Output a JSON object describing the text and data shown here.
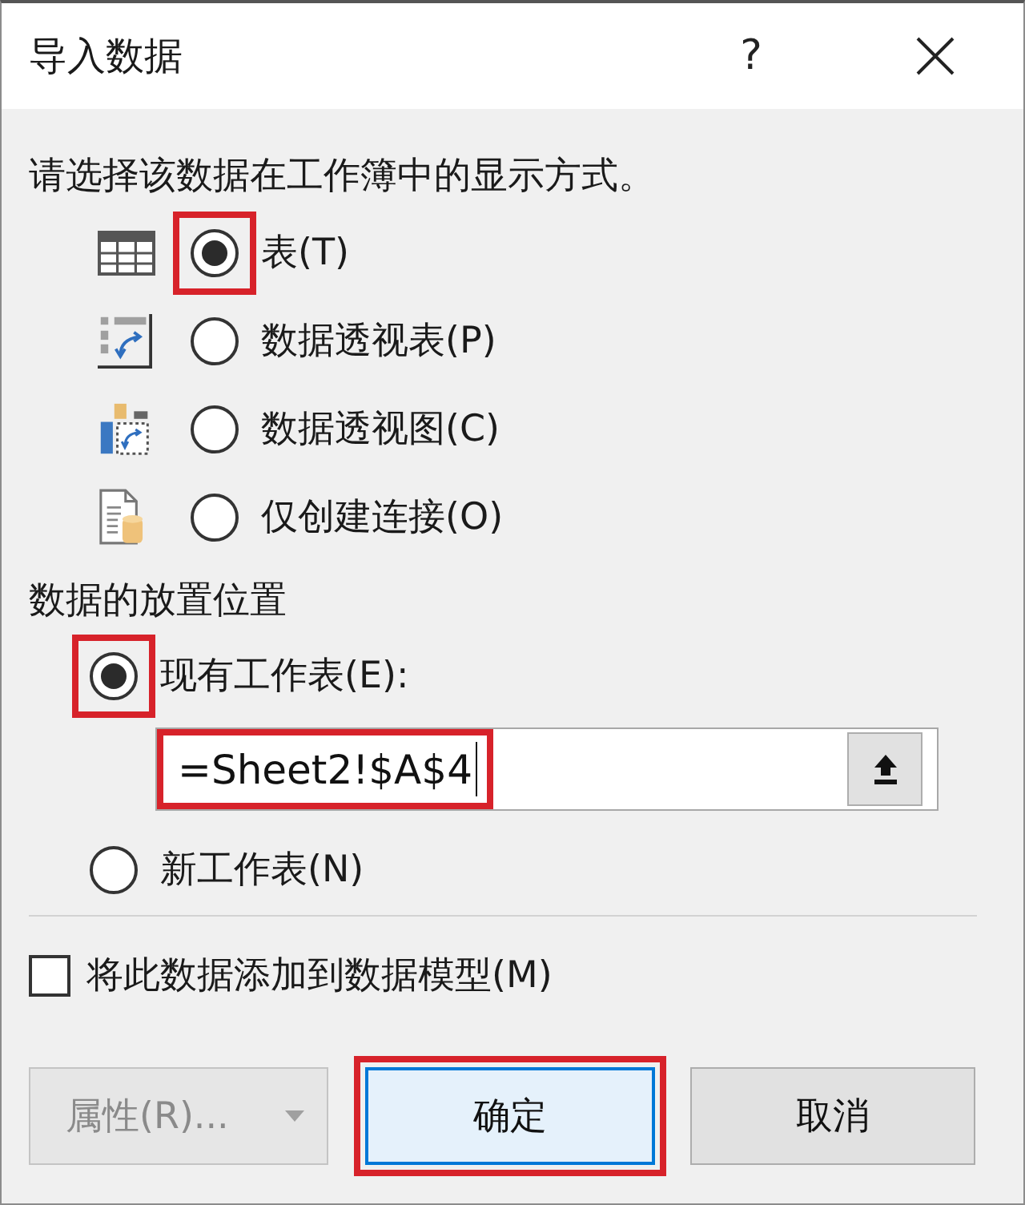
{
  "window": {
    "title": "导入数据",
    "help": "?"
  },
  "display": {
    "prompt": "请选择该数据在工作簿中的显示方式。",
    "options": [
      {
        "kind": "table",
        "label": "表(T)",
        "selected": true,
        "highlighted": true
      },
      {
        "kind": "pivot_table",
        "label": "数据透视表(P)",
        "selected": false,
        "highlighted": false
      },
      {
        "kind": "pivot_chart",
        "label": "数据透视图(C)",
        "selected": false,
        "highlighted": false
      },
      {
        "kind": "connection",
        "label": "仅创建连接(O)",
        "selected": false,
        "highlighted": false
      }
    ]
  },
  "location": {
    "heading": "数据的放置位置",
    "options": [
      {
        "label": "现有工作表(E):",
        "selected": true,
        "highlighted": true
      },
      {
        "label": "新工作表(N)",
        "selected": false,
        "highlighted": false
      }
    ],
    "field": {
      "value": "=Sheet2!$A$4",
      "highlighted": true
    }
  },
  "data_model": {
    "label": "将此数据添加到数据模型(M)",
    "checked": false
  },
  "buttons": [
    {
      "label": "属性(R)...",
      "disabled": true,
      "dropdown": true,
      "default": false,
      "highlighted": false
    },
    {
      "label": "确定",
      "disabled": false,
      "dropdown": false,
      "default": true,
      "highlighted": true
    },
    {
      "label": "取消",
      "disabled": false,
      "dropdown": false,
      "default": false,
      "highlighted": false
    }
  ]
}
